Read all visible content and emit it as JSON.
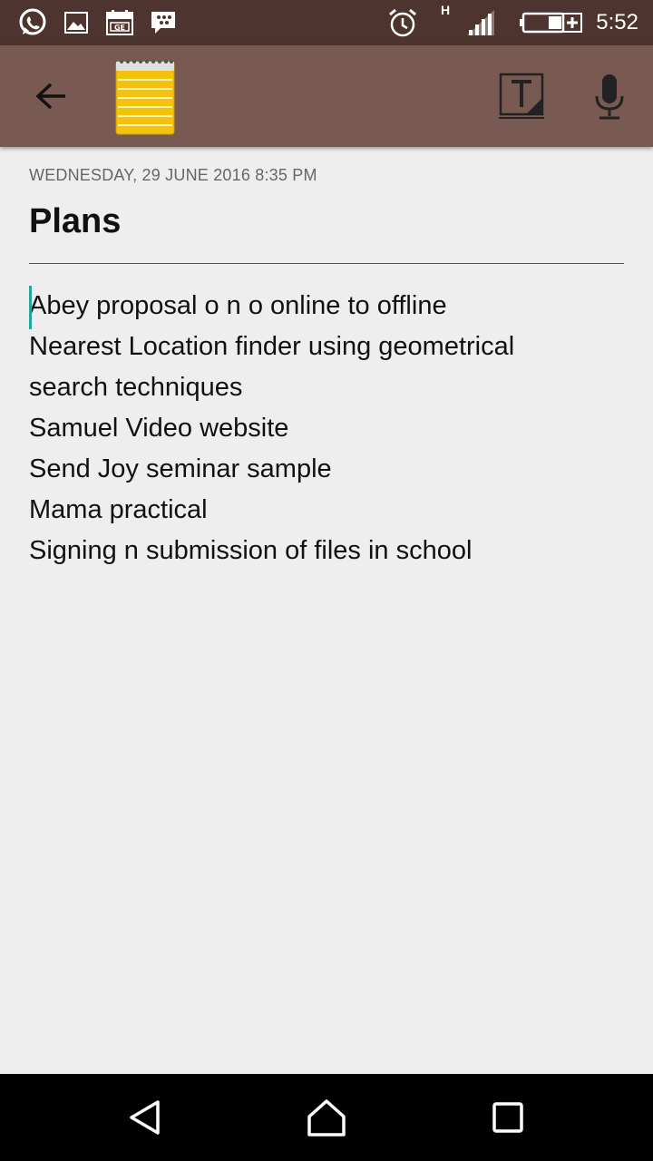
{
  "status_bar": {
    "time": "5:52",
    "network_type": "H",
    "icons": [
      "whatsapp-icon",
      "gallery-icon",
      "calendar-icon",
      "blackberry-messenger-icon",
      "alarm-icon",
      "signal-icon",
      "battery-charging-icon"
    ]
  },
  "app_bar": {
    "icons": [
      "back-arrow-icon",
      "notepad-icon",
      "text-format-icon",
      "microphone-icon"
    ],
    "background": "#795a53"
  },
  "note": {
    "date": "WEDNESDAY, 29 JUNE 2016 8:35 PM",
    "title": "Plans",
    "lines": [
      "Abey proposal o n o online to offline",
      "Nearest Location finder using geometrical",
      "search techniques",
      "Samuel Video website",
      "Send Joy seminar sample",
      "Mama practical",
      "Signing n submission of files in school"
    ]
  },
  "nav_bar": {
    "icons": [
      "back-triangle-icon",
      "home-icon",
      "recents-icon"
    ]
  },
  "colors": {
    "status_bar": "#4e342e",
    "cursor": "#26a69a",
    "background": "#eeeeee"
  }
}
